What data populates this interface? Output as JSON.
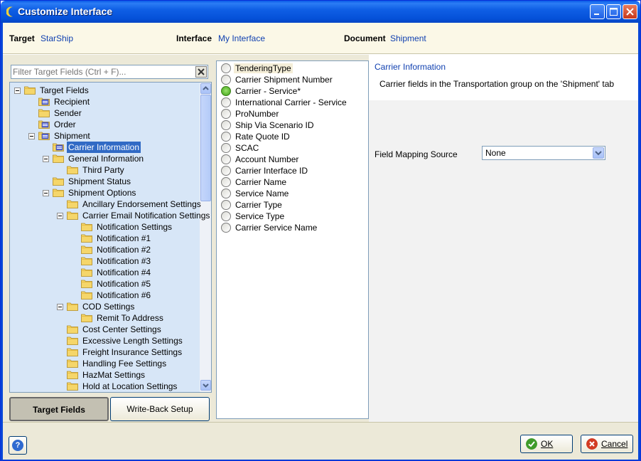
{
  "window": {
    "title": "Customize Interface"
  },
  "header": {
    "target_label": "Target",
    "target_value": "StarShip",
    "interface_label": "Interface",
    "interface_value": "My Interface",
    "document_label": "Document",
    "document_value": "Shipment"
  },
  "filter": {
    "placeholder": "Filter Target Fields (Ctrl + F)..."
  },
  "tree": [
    {
      "label": "Target Fields",
      "icon": "folder-icon"
    },
    {
      "label": "Recipient",
      "icon": "folder-table-icon"
    },
    {
      "label": "Sender",
      "icon": "folder-icon"
    },
    {
      "label": "Order",
      "icon": "folder-table-icon"
    },
    {
      "label": "Shipment",
      "icon": "folder-table-icon"
    },
    {
      "label": "Carrier Information",
      "icon": "folder-table-icon"
    },
    {
      "label": "General Information",
      "icon": "folder-icon"
    },
    {
      "label": "Third Party",
      "icon": "folder-icon"
    },
    {
      "label": "Shipment Status",
      "icon": "folder-icon"
    },
    {
      "label": "Shipment Options",
      "icon": "folder-icon"
    },
    {
      "label": "Ancillary Endorsement Settings",
      "icon": "folder-icon"
    },
    {
      "label": "Carrier Email Notification Settings",
      "icon": "folder-icon"
    },
    {
      "label": "Notification Settings",
      "icon": "folder-icon"
    },
    {
      "label": "Notification #1",
      "icon": "folder-icon"
    },
    {
      "label": "Notification #2",
      "icon": "folder-icon"
    },
    {
      "label": "Notification #3",
      "icon": "folder-icon"
    },
    {
      "label": "Notification #4",
      "icon": "folder-icon"
    },
    {
      "label": "Notification #5",
      "icon": "folder-icon"
    },
    {
      "label": "Notification #6",
      "icon": "folder-icon"
    },
    {
      "label": "COD Settings",
      "icon": "folder-icon"
    },
    {
      "label": "Remit To Address",
      "icon": "folder-icon"
    },
    {
      "label": "Cost Center Settings",
      "icon": "folder-icon"
    },
    {
      "label": "Excessive Length Settings",
      "icon": "folder-icon"
    },
    {
      "label": "Freight Insurance Settings",
      "icon": "folder-icon"
    },
    {
      "label": "Handling Fee Settings",
      "icon": "folder-icon"
    },
    {
      "label": "HazMat Settings",
      "icon": "folder-icon"
    },
    {
      "label": "Hold at Location Settings",
      "icon": "folder-icon"
    }
  ],
  "tabs": {
    "target_fields": "Target Fields",
    "write_back": "Write-Back Setup"
  },
  "fields": [
    {
      "label": "TenderingType"
    },
    {
      "label": "Carrier Shipment Number"
    },
    {
      "label": "Carrier - Service*"
    },
    {
      "label": "International Carrier - Service"
    },
    {
      "label": "ProNumber"
    },
    {
      "label": "Ship Via Scenario ID"
    },
    {
      "label": "Rate Quote ID"
    },
    {
      "label": "SCAC"
    },
    {
      "label": "Account Number"
    },
    {
      "label": "Carrier Interface ID"
    },
    {
      "label": "Carrier Name"
    },
    {
      "label": "Service Name"
    },
    {
      "label": "Carrier Type"
    },
    {
      "label": "Service Type"
    },
    {
      "label": "Carrier Service Name"
    }
  ],
  "detail": {
    "title": "Carrier Information",
    "description": "Carrier fields in the Transportation group on the 'Shipment' tab",
    "mapping_label": "Field Mapping Source",
    "mapping_value": "None"
  },
  "footer": {
    "ok_label": "OK",
    "cancel_label": "Cancel",
    "help_glyph": "?"
  },
  "colors": {
    "title_bar": "#0551d9",
    "link_blue": "#1040b0",
    "selection": "#316ac5",
    "tree_bg": "#d7e6f7"
  }
}
